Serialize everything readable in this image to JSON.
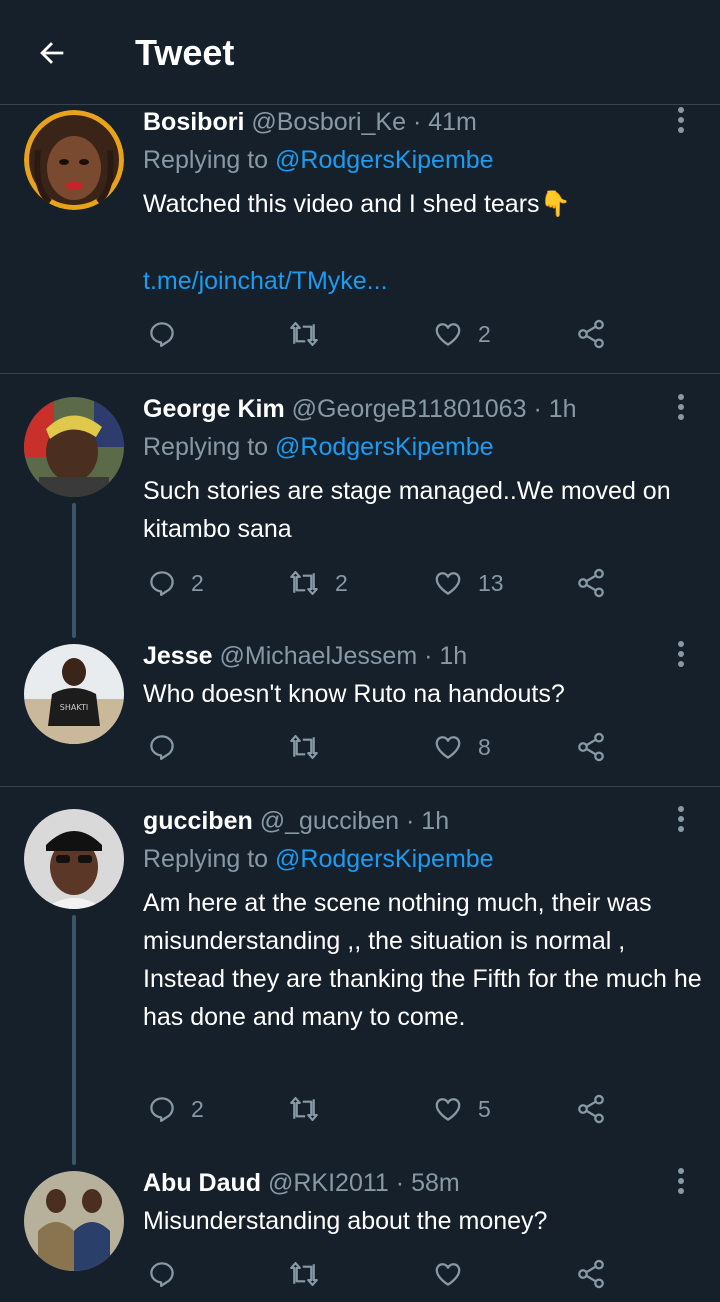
{
  "header": {
    "title": "Tweet"
  },
  "replying_prefix": "Replying to ",
  "tweets": [
    {
      "name": "Bosibori",
      "handle": "@Bosbori_Ke",
      "time": "41m",
      "replying_to": "@RodgersKipembe",
      "text": "Watched this video and I shed tears👇",
      "link": "t.me/joinchat/TMyke...",
      "replies": "",
      "retweets": "",
      "likes": "2"
    },
    {
      "name": "George Kim",
      "handle": "@GeorgeB11801063",
      "time": "1h",
      "replying_to": "@RodgersKipembe",
      "text": "Such stories are stage managed..We moved on kitambo sana",
      "replies": "2",
      "retweets": "2",
      "likes": "13"
    },
    {
      "name": "Jesse",
      "handle": "@MichaelJessem",
      "time": "1h",
      "text": "Who doesn't know Ruto na handouts?",
      "replies": "",
      "retweets": "",
      "likes": "8"
    },
    {
      "name": "gucciben",
      "handle": "@_gucciben",
      "time": "1h",
      "replying_to": "@RodgersKipembe",
      "text": "Am here at the scene nothing much, their was misunderstanding ,, the situation is normal , Instead they are thanking the Fifth for the much he has done  and many to come.",
      "replies": "2",
      "retweets": "",
      "likes": "5"
    },
    {
      "name": "Abu Daud",
      "handle": "@RKI2011",
      "time": "58m",
      "text": "Misunderstanding about the money?",
      "replies": "",
      "retweets": "",
      "likes": ""
    }
  ],
  "colors": {
    "background": "#15202b",
    "accent": "#1d9bf0",
    "muted": "#8899a6",
    "divider": "#38444d"
  },
  "icons": [
    "back-arrow-icon",
    "more-icon",
    "reply-icon",
    "retweet-icon",
    "like-icon",
    "share-icon"
  ]
}
